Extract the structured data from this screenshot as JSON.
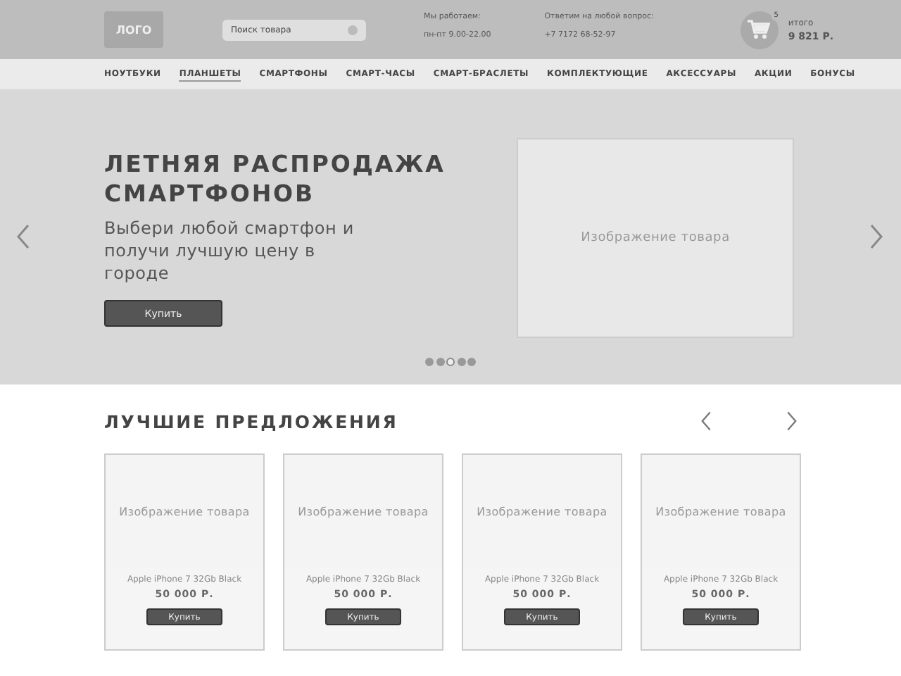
{
  "header": {
    "logo": "ЛОГО",
    "search": {
      "placeholder": "Поиск товара"
    },
    "hours_label": "Мы работаем:",
    "hours": "пн-пт 9.00-22.00",
    "phone_label": "Ответим на любой вопрос:",
    "phone": "+7 7172 68-52-97",
    "cart_count": "5",
    "total_label": "итого",
    "total": "9 821 Р."
  },
  "nav": [
    {
      "label": "НОУТБУКИ",
      "selected": false
    },
    {
      "label": "ПЛАНШЕТЫ",
      "selected": true
    },
    {
      "label": "СМАРТФОНЫ",
      "selected": false
    },
    {
      "label": "СМАРТ-ЧАСЫ",
      "selected": false
    },
    {
      "label": "СМАРТ-БРАСЛЕТЫ",
      "selected": false
    },
    {
      "label": "КОМПЛЕКТУЮЩИЕ",
      "selected": false
    },
    {
      "label": "АКСЕССУАРЫ",
      "selected": false
    },
    {
      "label": "АКЦИИ",
      "selected": false
    },
    {
      "label": "БОНУСЫ",
      "selected": false
    }
  ],
  "hero": {
    "title": "ЛЕТНЯЯ РАСПРОДАЖА СМАРТФОНОВ",
    "subtitle": "Выбери любой смартфон и получи лучшую цену в городе",
    "button": "Купить",
    "image_text": "Изображение товара",
    "dots": [
      {
        "selected": false
      },
      {
        "selected": false
      },
      {
        "selected": true
      },
      {
        "selected": false
      },
      {
        "selected": false
      }
    ]
  },
  "offers": {
    "title": "ЛУЧШИЕ ПРЕДЛОЖЕНИЯ",
    "products": [
      {
        "image_text": "Изображение товара",
        "name": "Apple iPhone 7 32Gb Black",
        "price": "50 000 Р.",
        "button": "Купить"
      },
      {
        "image_text": "Изображение товара",
        "name": "Apple iPhone 7 32Gb Black",
        "price": "50 000 Р.",
        "button": "Купить"
      },
      {
        "image_text": "Изображение товара",
        "name": "Apple iPhone 7 32Gb Black",
        "price": "50 000 Р.",
        "button": "Купить"
      },
      {
        "image_text": "Изображение товара",
        "name": "Apple iPhone 7 32Gb Black",
        "price": "50 000 Р.",
        "button": "Купить"
      }
    ]
  }
}
